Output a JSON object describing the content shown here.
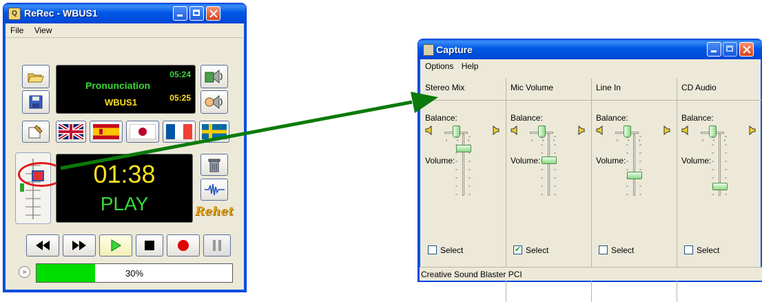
{
  "rerec": {
    "title": "ReRec - WBUS1",
    "menu": [
      "File",
      "View"
    ],
    "display": {
      "line1": "Pronunciation",
      "line2": "WBUS1",
      "time1": "05:24",
      "time2": "05:25"
    },
    "main_time": "01:38",
    "main_status": "PLAY",
    "logo": "Rehet",
    "progress": {
      "percent": 30,
      "label": "30%"
    },
    "flags": [
      "uk",
      "spain",
      "japan",
      "france",
      "sweden"
    ],
    "colors": {
      "lcd_green": "#39d839",
      "lcd_yellow": "#ffe020",
      "progress_green": "#00dd00",
      "record_red": "#e00000"
    }
  },
  "capture": {
    "title": "Capture",
    "menu": [
      "Options",
      "Help"
    ],
    "columns": [
      {
        "name": "Stereo Mix",
        "balance_label": "Balance:",
        "volume_label": "Volume:",
        "balance": 0.5,
        "volume": 0.8,
        "select_label": "Select",
        "selected": false
      },
      {
        "name": "Mic Volume",
        "balance_label": "Balance:",
        "volume_label": "Volume:",
        "balance": 0.5,
        "volume": 0.58,
        "select_label": "Select",
        "selected": true
      },
      {
        "name": "Line In",
        "balance_label": "Balance:",
        "volume_label": "Volume:",
        "balance": 0.5,
        "volume": 0.3,
        "select_label": "Select",
        "selected": false
      },
      {
        "name": "CD Audio",
        "balance_label": "Balance:",
        "volume_label": "Volume:",
        "balance": 0.5,
        "volume": 0.1,
        "select_label": "Select",
        "selected": false
      }
    ],
    "status": "Creative Sound Blaster PCI"
  },
  "annotation": {
    "arrow_color": "#0a7a0a",
    "circle_color": "#e01818"
  }
}
